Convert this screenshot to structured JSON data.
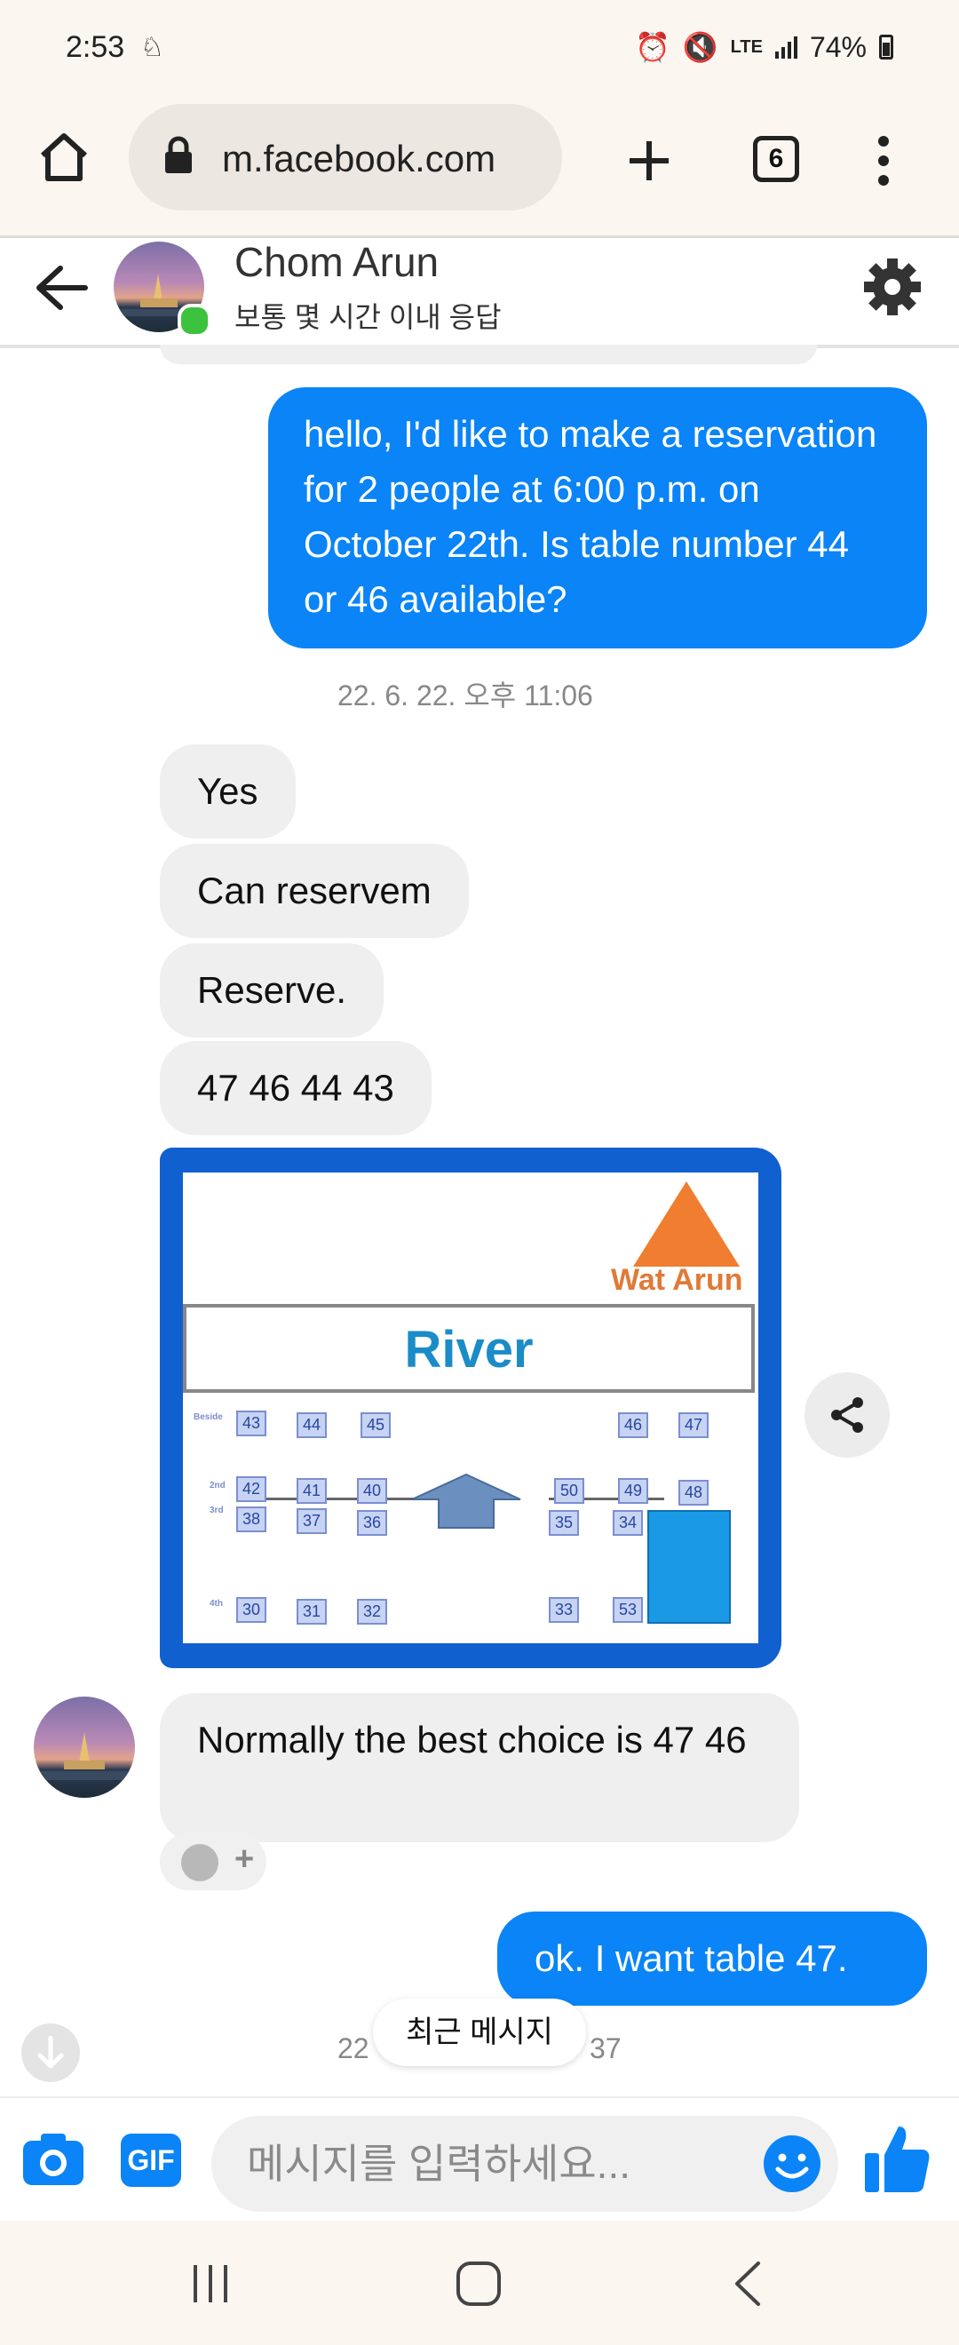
{
  "status": {
    "time": "2:53",
    "battery": "74%",
    "network": "LTE"
  },
  "browser": {
    "url": "m.facebook.com",
    "tab_count": "6"
  },
  "chat": {
    "contact_name": "Chom Arun",
    "contact_status": "보통 몇 시간 이내 응답"
  },
  "messages": {
    "out1": "hello, I'd like to make a reservation for 2 people at 6:00 p.m. on October 22th. Is table number 44 or 46 available?",
    "ts1": "22. 6. 22. 오후 11:06",
    "in1": "Yes",
    "in2": "Can reservem",
    "in3": "Reserve.",
    "in4": "47 46 44 43",
    "in5": "Normally the best choice is 47 46",
    "out2": "ok. I want table 47.",
    "ts2_left": "22",
    "ts2_right": "37",
    "recent_label": "최근 메시지"
  },
  "seatmap": {
    "river_label": "River",
    "temple_label": "Wat Arun",
    "row_beside": "Beside",
    "row_2nd": "2nd",
    "row_3rd": "3rd",
    "row_4th": "4th",
    "tables": [
      "43",
      "44",
      "45",
      "46",
      "47",
      "42",
      "41",
      "40",
      "50",
      "49",
      "48",
      "38",
      "37",
      "36",
      "35",
      "34",
      "30",
      "31",
      "32",
      "33",
      "53"
    ]
  },
  "composer": {
    "placeholder": "메시지를 입력하세요..."
  },
  "colors": {
    "accent": "#0a84f7",
    "bubble_in": "#efefef",
    "online": "#3cc23c"
  }
}
